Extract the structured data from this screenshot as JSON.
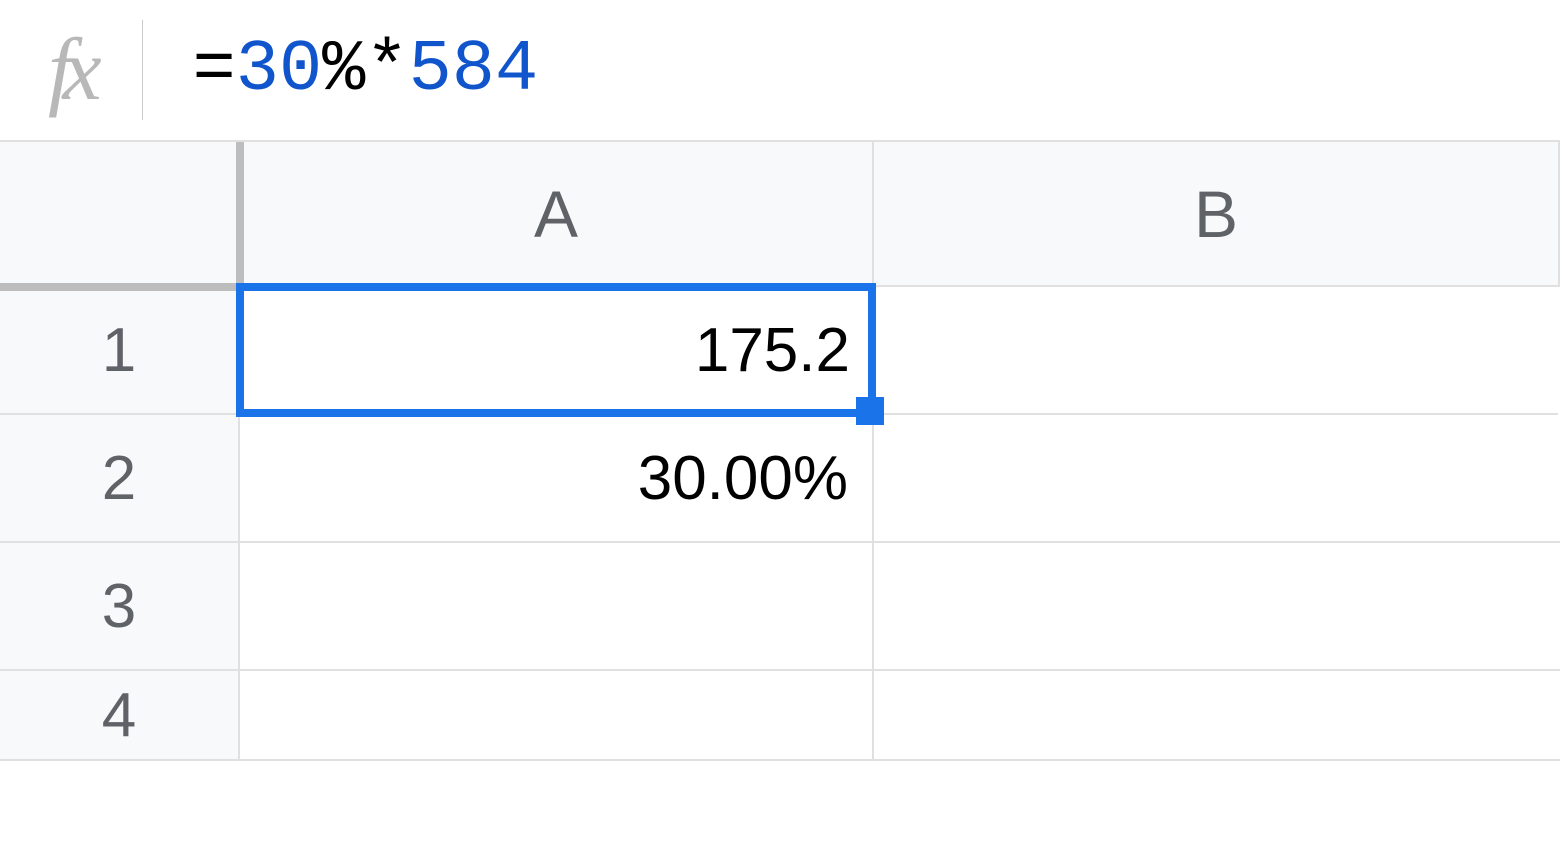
{
  "formula_bar": {
    "prefix": "=",
    "tokens": [
      {
        "text": "30",
        "class": "num"
      },
      {
        "text": "%*",
        "class": "op"
      },
      {
        "text": "584",
        "class": "num"
      }
    ]
  },
  "columns": [
    "A",
    "B"
  ],
  "rows": [
    "1",
    "2",
    "3",
    "4"
  ],
  "cells": {
    "A1": "175.2",
    "A2": "30.00%",
    "A3": "",
    "A4": "",
    "B1": "",
    "B2": "",
    "B3": "",
    "B4": ""
  },
  "selected_cell": "A1"
}
